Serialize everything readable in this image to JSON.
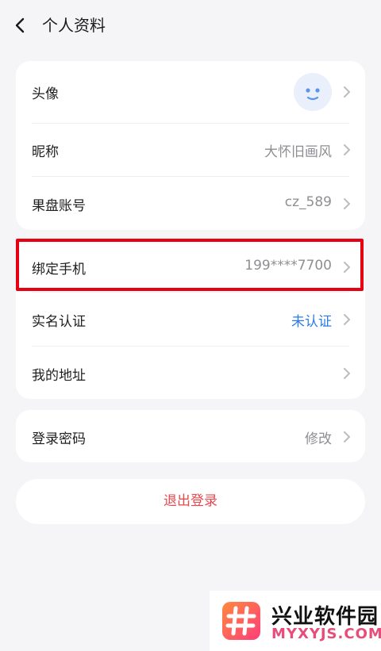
{
  "header": {
    "title": "个人资料"
  },
  "profile": {
    "avatar_label": "头像",
    "nickname_label": "昵称",
    "nickname_value": "大怀旧画风",
    "account_label": "果盘账号",
    "account_value": "cz_589"
  },
  "security": {
    "phone_label": "绑定手机",
    "phone_value": "199****7700",
    "realname_label": "实名认证",
    "realname_value": "未认证",
    "address_label": "我的地址"
  },
  "password": {
    "label": "登录密码",
    "value": "修改"
  },
  "logout_label": "退出登录",
  "watermark": {
    "name": "兴业软件园",
    "url": "MYXYJS.COM"
  },
  "colors": {
    "page_bg": "#f5f5f7",
    "card_bg": "#ffffff",
    "highlight": "#e60012",
    "link_blue": "#2c7be5",
    "logout_red": "#e5484d"
  }
}
